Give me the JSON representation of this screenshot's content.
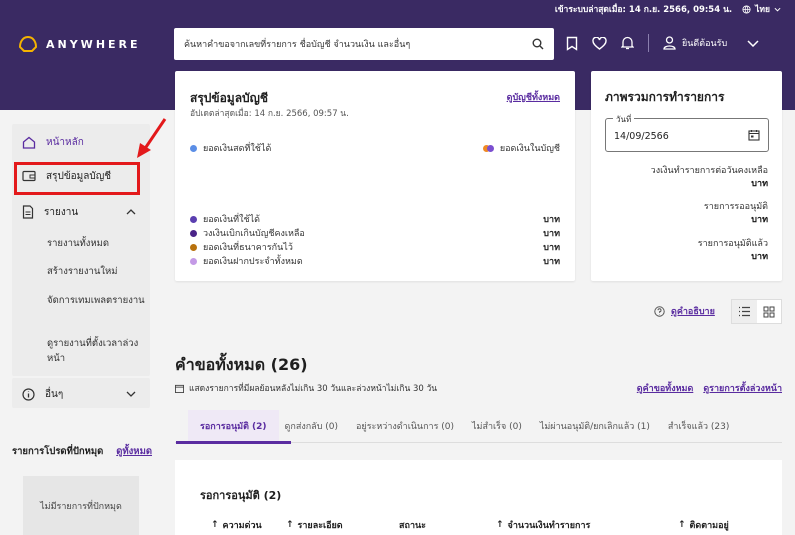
{
  "topbar": {
    "last_login": "เข้าระบบล่าสุดเมื่อ: 14 ก.ย. 2566, 09:54 น.",
    "language": "ไทย"
  },
  "header": {
    "logo_text": "ANYWHERE",
    "search_placeholder": "ค้นหาคำขอจากเลขที่รายการ ชื่อบัญชี จำนวนเงิน และอื่นๆ",
    "welcome": "ยินดีต้อนรับ"
  },
  "sidebar": {
    "home": "หน้าหลัก",
    "account_summary": "สรุปข้อมูลบัญชี",
    "reports": "รายงาน",
    "report_items": [
      "รายงานทั้งหมด",
      "สร้างรายงานใหม่",
      "จัดการเทมเพลตรายงาน",
      "ดูรายงานที่ตั้งเวลาล่วงหน้า"
    ],
    "others": "อื่นๆ",
    "favorites_title": "รายการโปรดที่ปักหมุด",
    "favorites_view_all": "ดูทั้งหมด",
    "favorites_empty": "ไม่มีรายการที่ปักหมุด"
  },
  "summary_card": {
    "title": "สรุปข้อมูลบัญชี",
    "updated": "อัปเดตล่าสุดเมื่อ: 14 ก.ย. 2566, 09:57 น.",
    "view_all": "ดูบัญชีทั้งหมด",
    "legend_left": "ยอดเงินสดที่ใช้ได้",
    "legend_right": "ยอดเงินในบัญชี",
    "rows": [
      {
        "label": "ยอดเงินที่ใช้ได้",
        "unit": "บาท",
        "color": "#5b3fb0"
      },
      {
        "label": "วงเงินเบิกเกินบัญชีคงเหลือ",
        "unit": "บาท",
        "color": "#4a2488"
      },
      {
        "label": "ยอดเงินที่ธนาคารกันไว้",
        "unit": "บาท",
        "color": "#b8720d"
      },
      {
        "label": "ยอดเงินฝากประจำทั้งหมด",
        "unit": "บาท",
        "color": "#c49ae6"
      }
    ]
  },
  "overview_card": {
    "title": "ภาพรวมการทำรายการ",
    "date_label": "วันที่",
    "date_value": "14/09/2566",
    "stats": [
      {
        "label": "วงเงินทำรายการต่อวันคงเหลือ",
        "unit": "บาท"
      },
      {
        "label": "รายการรออนุมัติ",
        "unit": "บาท"
      },
      {
        "label": "รายการอนุมัติแล้ว",
        "unit": "บาท"
      }
    ]
  },
  "help_link": "ดูคำอธิบาย",
  "requests": {
    "title": "คำขอทั้งหมด (26)",
    "subtitle": "แสดงรายการที่มีผลย้อนหลังไม่เกิน 30 วันและล่วงหน้าไม่เกิน 30 วัน",
    "view_all": "ดูคำขอทั้งหมด",
    "scheduled": "ดูรายการตั้งล่วงหน้า",
    "tabs": [
      "รอการอนุมัติ (2)",
      "ดูกส่งกลับ (0)",
      "อยู่ระหว่างดำเนินการ (0)",
      "ไม่สำเร็จ (0)",
      "ไม่ผ่านอนุมัติ/ยกเลิกแล้ว (1)",
      "สำเร็จแล้ว (23)"
    ],
    "section_title": "รอการอนุมัติ (2)",
    "columns": [
      "ความด่วน",
      "รายละเอียด",
      "สถานะ",
      "จำนวนเงินทำรายการ",
      "ติดตามอยู่"
    ]
  },
  "colors": {
    "brand": "#3a2a63",
    "accent": "#5a2ca0",
    "highlight": "#e3191b"
  }
}
